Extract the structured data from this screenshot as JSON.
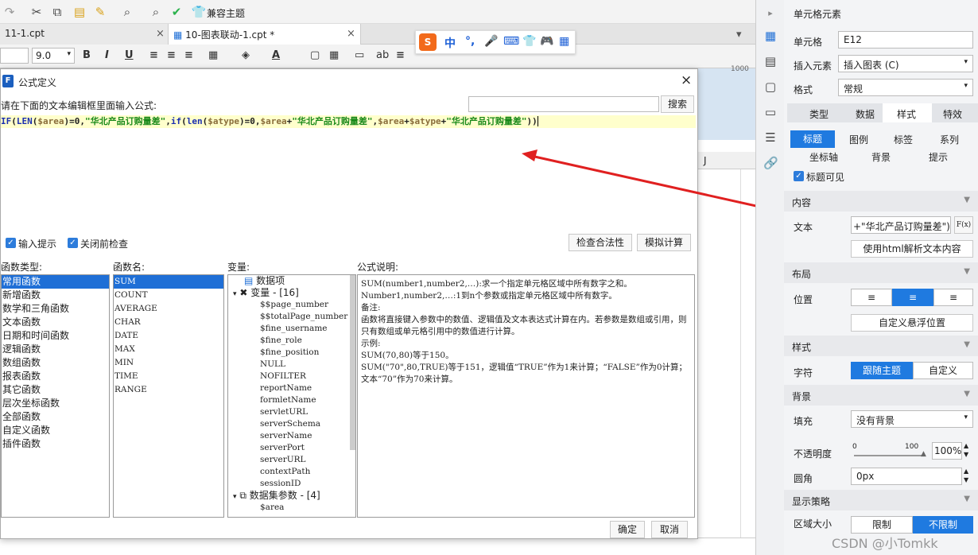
{
  "toolbar": {
    "compat_theme": "兼容主题"
  },
  "tabs": [
    {
      "label": "11-1.cpt"
    },
    {
      "label": "10-图表联动-1.cpt *"
    }
  ],
  "format_bar": {
    "font_size": "9.0",
    "bold": "B",
    "italic": "I",
    "underline": "U",
    "abc": "ab"
  },
  "ime": {
    "mode": "中"
  },
  "sheet": {
    "col_j": "J",
    "ruler_1000": "1000"
  },
  "dialog": {
    "title": "公式定义",
    "prompt": "请在下面的文本编辑框里面输入公式:",
    "search_button": "搜索",
    "formula": "IF(LEN($area)=0,\"华北产品订购量差\",if(len($atype)=0,$area+\"华北产品订购量差\",$area+$atype+\"华北产品订购量差\"))",
    "input_hint": "输入提示",
    "close_check": "关闭前检查",
    "validate_button": "检查合法性",
    "simulate_button": "模拟计算",
    "func_type_header": "函数类型:",
    "func_name_header": "函数名:",
    "var_header": "变量:",
    "desc_header": "公式说明:",
    "func_types": [
      "常用函数",
      "新增函数",
      "数学和三角函数",
      "文本函数",
      "日期和时间函数",
      "逻辑函数",
      "数组函数",
      "报表函数",
      "其它函数",
      "层次坐标函数",
      "全部函数",
      "自定义函数",
      "插件函数"
    ],
    "func_names": [
      "SUM",
      "COUNT",
      "AVERAGE",
      "CHAR",
      "DATE",
      "MAX",
      "MIN",
      "TIME",
      "RANGE"
    ],
    "var_data_item": "数据项",
    "var_group": "变量 - [16]",
    "variables": [
      "$$page_number",
      "$$totalPage_number",
      "$fine_username",
      "$fine_role",
      "$fine_position",
      "NULL",
      "NOFILTER",
      "reportName",
      "formletName",
      "servletURL",
      "serverSchema",
      "serverName",
      "serverPort",
      "serverURL",
      "contextPath",
      "sessionID"
    ],
    "ds_param_group": "数据集参数 - [4]",
    "ds_params": [
      "$area"
    ],
    "desc_lines": [
      "SUM(number1,number2,…):求一个指定单元格区域中所有数字之和。",
      "Number1,number2,…:1到n个参数或指定单元格区域中所有数字。",
      "备注:",
      "函数将直接键入参数中的数值、逻辑值及文本表达式计算在内。若参数是数组或引用，则只有数组或单元格引用中的数值进行计算。",
      "示例:",
      "SUM(70,80)等于150。",
      "SUM(\"70\",80,TRUE)等于151，逻辑值“TRUE”作为1来计算；“FALSE”作为0计算；文本“70”作为70来计算。"
    ],
    "ok_button": "确定",
    "cancel_button": "取消"
  },
  "panel": {
    "header": "单元格元素",
    "cell_label": "单元格",
    "cell_value": "E12",
    "insert_label": "插入元素",
    "insert_value": "插入图表 (C)",
    "format_label": "格式",
    "format_value": "常规",
    "tabs": [
      "类型",
      "数据",
      "样式",
      "特效"
    ],
    "subtabs_row1": [
      "标题",
      "图例",
      "标签",
      "系列"
    ],
    "subtabs_row2": [
      "坐标轴",
      "背景",
      "提示"
    ],
    "title_visible": "标题可见",
    "content_section": "内容",
    "text_label": "文本",
    "text_value": "+\"华北产品订购量差\"))",
    "fx_button": "F(x)",
    "html_button": "使用html解析文本内容",
    "layout_section": "布局",
    "position_label": "位置",
    "custom_float": "自定义悬浮位置",
    "style_section": "样式",
    "font_label": "字符",
    "follow_theme": "跟随主题",
    "custom": "自定义",
    "bg_section": "背景",
    "fill_label": "填充",
    "fill_value": "没有背景",
    "opacity_label": "不透明度",
    "opacity_min": "0",
    "opacity_max": "100",
    "opacity_value": "100%",
    "radius_label": "圆角",
    "radius_value": "0px",
    "display_section": "显示策略",
    "area_size_label": "区域大小",
    "limit": "限制",
    "no_limit": "不限制"
  },
  "watermark": "CSDN @小Tomkk"
}
